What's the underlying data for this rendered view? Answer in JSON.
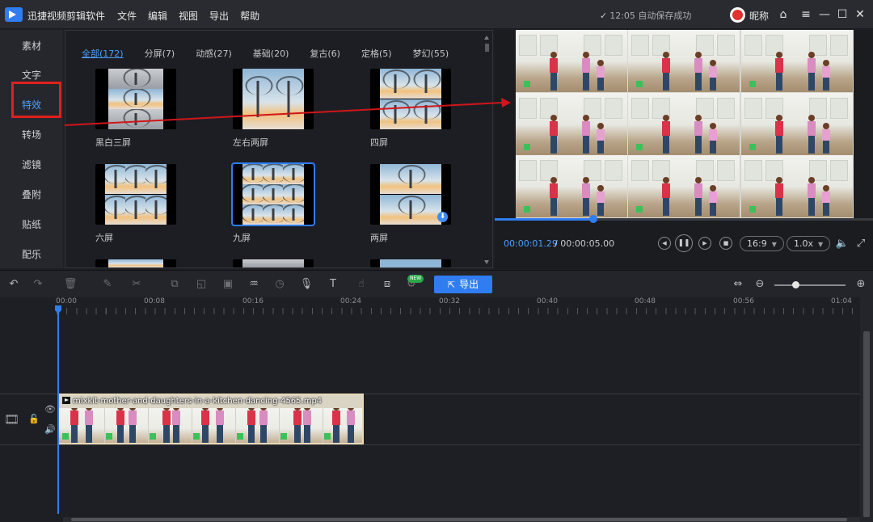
{
  "app": {
    "title": "迅捷视频剪辑软件",
    "menu": [
      "文件",
      "编辑",
      "视图",
      "导出",
      "帮助"
    ],
    "save_status": "12:05 自动保存成功",
    "nickname": "昵称"
  },
  "left_nav": {
    "items": [
      "素材",
      "文字",
      "特效",
      "转场",
      "滤镜",
      "叠附",
      "贴纸",
      "配乐"
    ],
    "active": "特效"
  },
  "effects": {
    "tabs": [
      "全部(172)",
      "分屏(7)",
      "动感(27)",
      "基础(20)",
      "复古(6)",
      "定格(5)",
      "梦幻(55)"
    ],
    "active_tab": "全部(172)",
    "items": [
      {
        "label": "黑白三屏"
      },
      {
        "label": "左右两屏"
      },
      {
        "label": "四屏"
      },
      {
        "label": "六屏"
      },
      {
        "label": "九屏",
        "selected": true
      },
      {
        "label": "两屏",
        "downloadable": true
      }
    ]
  },
  "preview": {
    "time_current": "00:00:01.29",
    "time_total": "/ 00:00:05.00",
    "progress_fraction": 0.26,
    "aspect_ratio": "16:9",
    "speed": "1.0x"
  },
  "toolbar": {
    "export_label": "导出",
    "new_badge": "NEW",
    "zoom_fraction": 0.3
  },
  "timeline": {
    "ruler_labels": [
      "00:00",
      "00:08",
      "00:16",
      "00:24",
      "00:32",
      "00:40",
      "00:48",
      "00:56",
      "01:04"
    ],
    "clip_name": "mixkit-mother-and-daughters-in-a-kitchen-dancing-4565.mp4"
  },
  "colors": {
    "accent": "#2f7df1",
    "highlight_box": "#e0201c",
    "annotation_arrow": "#d0161a"
  }
}
